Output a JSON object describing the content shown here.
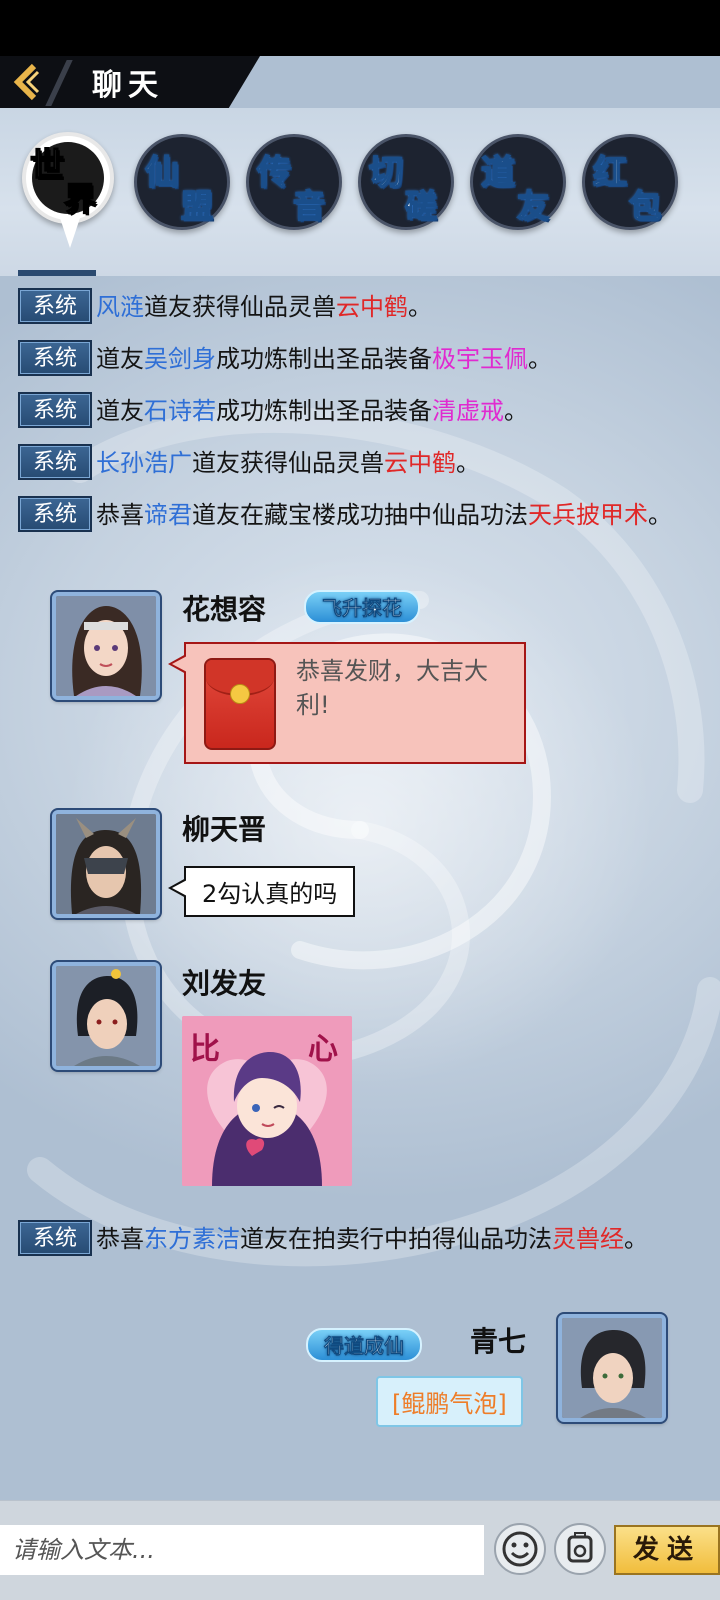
{
  "header": {
    "title": "聊天"
  },
  "tabs": [
    {
      "top": "世",
      "bottom": "界",
      "active": true
    },
    {
      "top": "仙",
      "bottom": "盟",
      "active": false
    },
    {
      "top": "传",
      "bottom": "音",
      "active": false
    },
    {
      "top": "切",
      "bottom": "磋",
      "active": false
    },
    {
      "top": "道",
      "bottom": "友",
      "active": false
    },
    {
      "top": "红",
      "bottom": "包",
      "active": false
    }
  ],
  "system_label": "系统",
  "system_messages": [
    {
      "segments": [
        {
          "text": "风涟",
          "color": "blue"
        },
        {
          "text": "道友获得仙品灵兽"
        },
        {
          "text": "云中鹤",
          "color": "red"
        },
        {
          "text": "。"
        }
      ]
    },
    {
      "segments": [
        {
          "text": "道友"
        },
        {
          "text": "吴剑身",
          "color": "blue"
        },
        {
          "text": "成功炼制出圣品装备"
        },
        {
          "text": "极宇玉佩",
          "color": "pink"
        },
        {
          "text": "。"
        }
      ]
    },
    {
      "segments": [
        {
          "text": "道友"
        },
        {
          "text": "石诗若",
          "color": "blue"
        },
        {
          "text": "成功炼制出圣品装备"
        },
        {
          "text": "清虚戒",
          "color": "pink"
        },
        {
          "text": "。"
        }
      ]
    },
    {
      "segments": [
        {
          "text": "长孙浩广",
          "color": "blue"
        },
        {
          "text": "道友获得仙品灵兽"
        },
        {
          "text": "云中鹤",
          "color": "red"
        },
        {
          "text": "。"
        }
      ]
    },
    {
      "segments": [
        {
          "text": "恭喜"
        },
        {
          "text": "谛君",
          "color": "blue"
        },
        {
          "text": "道友在藏宝楼成功抽中仙品功法"
        },
        {
          "text": "天兵披甲术",
          "color": "red"
        },
        {
          "text": "。"
        }
      ]
    },
    {
      "segments": [
        {
          "text": "恭喜"
        },
        {
          "text": "东方素洁",
          "color": "blue"
        },
        {
          "text": "道友在拍卖行中拍得仙品功法"
        },
        {
          "text": "灵兽经",
          "color": "red"
        },
        {
          "text": "。"
        }
      ]
    }
  ],
  "chats": {
    "huaxiangrong": {
      "name": "花想容",
      "badge": "飞升探花",
      "red_packet_text": "恭喜发财，大吉大利!"
    },
    "liutianjin": {
      "name": "柳天晋",
      "text": "2勾认真的吗"
    },
    "liufayou": {
      "name": "刘发友",
      "sticker_left": "比",
      "sticker_right": "心"
    },
    "qingqi": {
      "name": "青七",
      "badge": "得道成仙",
      "text": "[鲲鹏气泡]"
    }
  },
  "input": {
    "placeholder": "请输入文本..."
  },
  "send_label": "发送",
  "icons": {
    "back": "back-chevron-icon",
    "emoji": "smiley-icon",
    "sticker": "sticker-icon"
  },
  "colors": {
    "blue": "#2f6fd6",
    "red": "#e02828",
    "pink": "#e02ad0",
    "system_badge": "#2b4a70",
    "send": "#f1bd3c"
  }
}
